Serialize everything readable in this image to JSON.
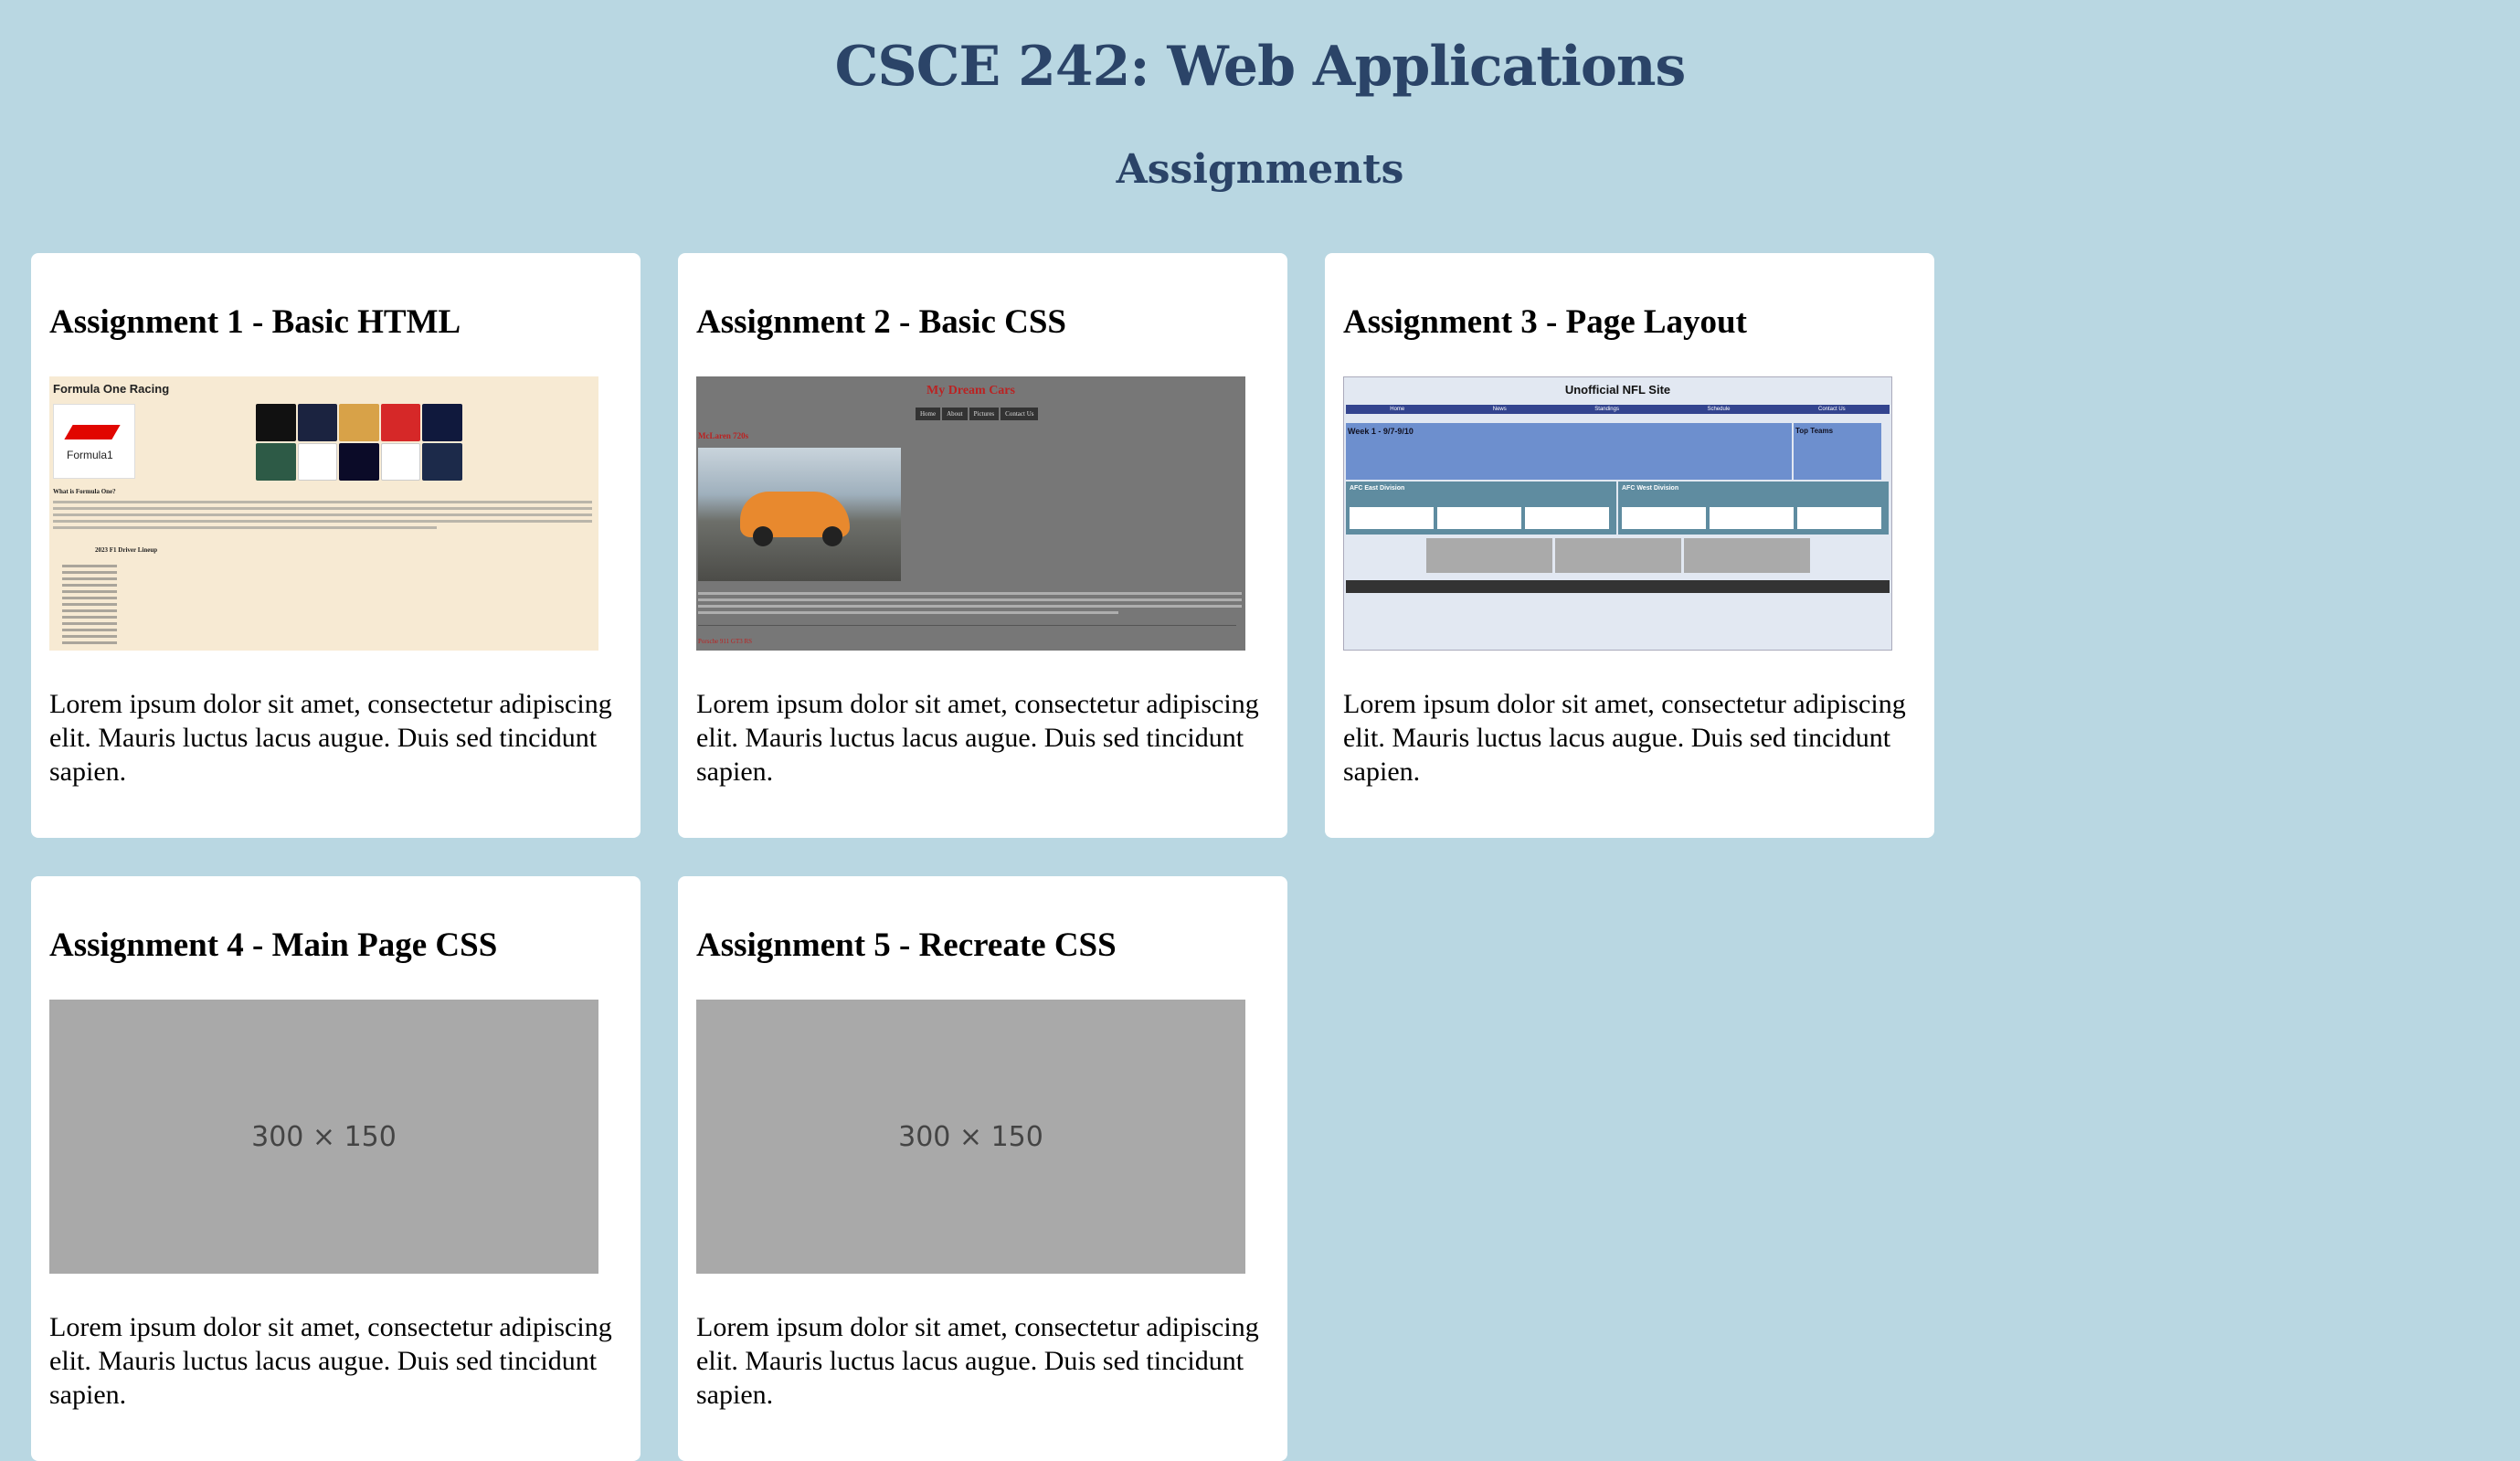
{
  "header": {
    "title": "CSCE 242: Web Applications",
    "subtitle": "Assignments"
  },
  "colors": {
    "background": "#b9d7e2",
    "heading": "#2b4468",
    "card": "#ffffff",
    "placeholder": "#a9a9a9"
  },
  "assignments": [
    {
      "title": "Assignment 1 - Basic HTML",
      "description": "Lorem ipsum dolor sit amet, consectetur adipiscing elit. Mauris luctus lacus augue. Duis sed tincidunt sapien.",
      "thumbnail": {
        "heading": "Formula One Racing",
        "logo_text": "Formula1",
        "section_label": "What is Formula One?",
        "lineup_label": "2023 F1 Driver Lineup"
      }
    },
    {
      "title": "Assignment 2 - Basic CSS",
      "description": "Lorem ipsum dolor sit amet, consectetur adipiscing elit. Mauris luctus lacus augue. Duis sed tincidunt sapien.",
      "thumbnail": {
        "heading": "My Dream Cars",
        "nav": [
          "Home",
          "About",
          "Pictures",
          "Contact Us"
        ],
        "subheading": "McLaren 720s",
        "footer": "Porsche 911 GT3 RS"
      }
    },
    {
      "title": "Assignment 3 - Page Layout",
      "description": "Lorem ipsum dolor sit amet, consectetur adipiscing elit. Mauris luctus lacus augue. Duis sed tincidunt sapien.",
      "thumbnail": {
        "heading": "Unofficial NFL Site",
        "nav": [
          "Home",
          "News",
          "Standings",
          "Schedule",
          "Contact Us"
        ],
        "week_label": "Week 1 - 9/7-9/10",
        "top_teams_label": "Top Teams",
        "divisions": [
          "AFC East Division",
          "AFC West Division"
        ]
      }
    },
    {
      "title": "Assignment 4 - Main Page CSS",
      "description": "Lorem ipsum dolor sit amet, consectetur adipiscing elit. Mauris luctus lacus augue. Duis sed tincidunt sapien.",
      "thumbnail": {
        "placeholder": "300 × 150"
      }
    },
    {
      "title": "Assignment 5 - Recreate CSS",
      "description": "Lorem ipsum dolor sit amet, consectetur adipiscing elit. Mauris luctus lacus augue. Duis sed tincidunt sapien.",
      "thumbnail": {
        "placeholder": "300 × 150"
      }
    }
  ]
}
